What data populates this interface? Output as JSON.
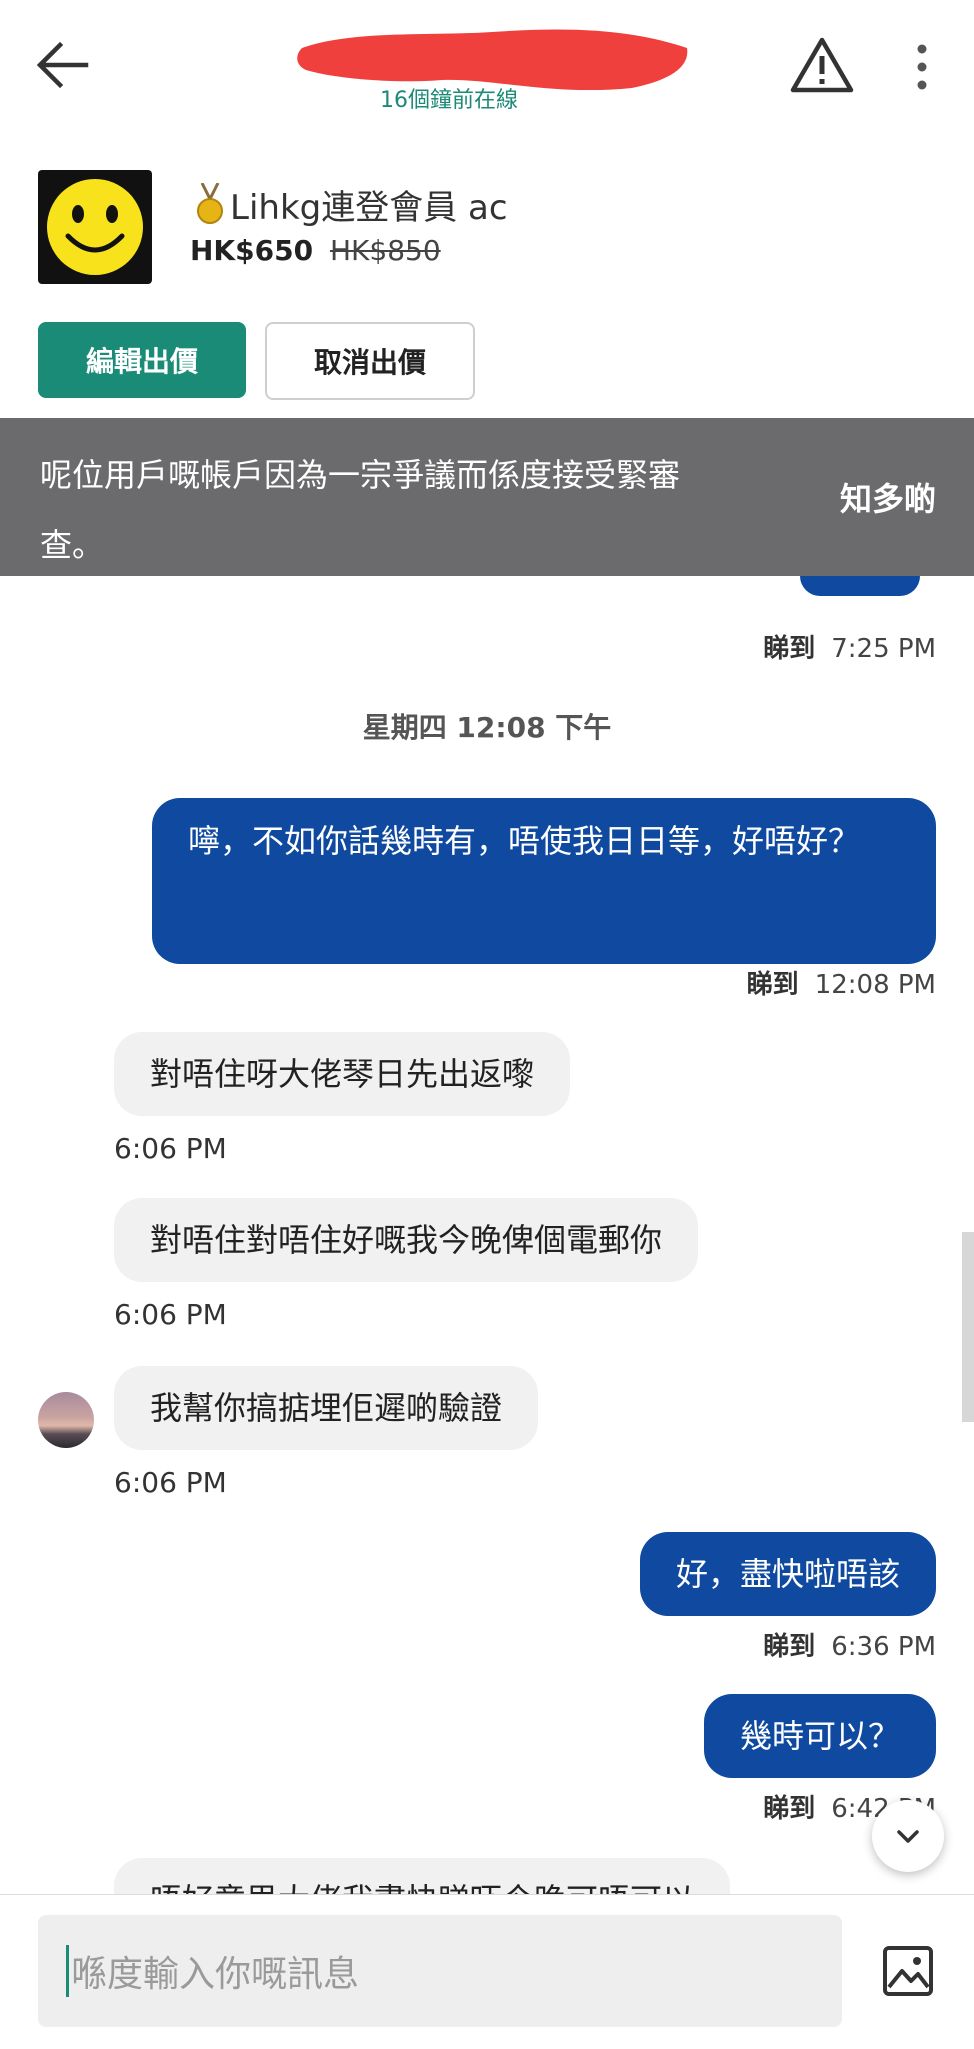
{
  "header": {
    "last_seen": "16個鐘前在線",
    "back_icon": "arrow-left-icon",
    "warn_icon": "warning-triangle-icon",
    "more_icon": "more-vertical-icon",
    "redaction_color": "#f0403e"
  },
  "listing": {
    "title": "Lihkg連登會員 ac",
    "price": "HK$650",
    "original_price": "HK$850",
    "edit_offer_label": "編輯出價",
    "cancel_offer_label": "取消出價",
    "accent": "#1a8b77"
  },
  "banner": {
    "text": "呢位用戶嘅帳戶因為一宗爭議而係度接受緊審查。",
    "link": "知多啲"
  },
  "chat": {
    "top_meta": {
      "seen": "睇到",
      "time": "7:25 PM"
    },
    "date_separator": "星期四 12:08 下午",
    "messages": [
      {
        "dir": "out",
        "text": "嚀，不如你話幾時有，唔使我日日等，好唔好？",
        "seen": "睇到",
        "time": "12:08 PM"
      },
      {
        "dir": "in",
        "text": "對唔住呀大佬琴日先出返嚟",
        "time": "6:06 PM"
      },
      {
        "dir": "in",
        "text": "對唔住對唔住好嘅我今晚俾個電郵你",
        "time": "6:06 PM"
      },
      {
        "dir": "in",
        "text": "我幫你搞掂埋佢遲啲驗證",
        "time": "6:06 PM"
      },
      {
        "dir": "out",
        "text": "好，盡快啦唔該",
        "seen": "睇到",
        "time": "6:36 PM"
      },
      {
        "dir": "out",
        "text": "幾時可以？",
        "seen": "睇到",
        "time": "6:42 PM"
      },
      {
        "dir": "in",
        "text": "唔好意思大佬我盡快睇吓今晚可唔可以"
      }
    ],
    "bubble_out_color": "#0f4aa0",
    "bubble_in_color": "#f1f1f1"
  },
  "input": {
    "placeholder": "喺度輸入你嘅訊息",
    "image_icon": "image-icon"
  }
}
